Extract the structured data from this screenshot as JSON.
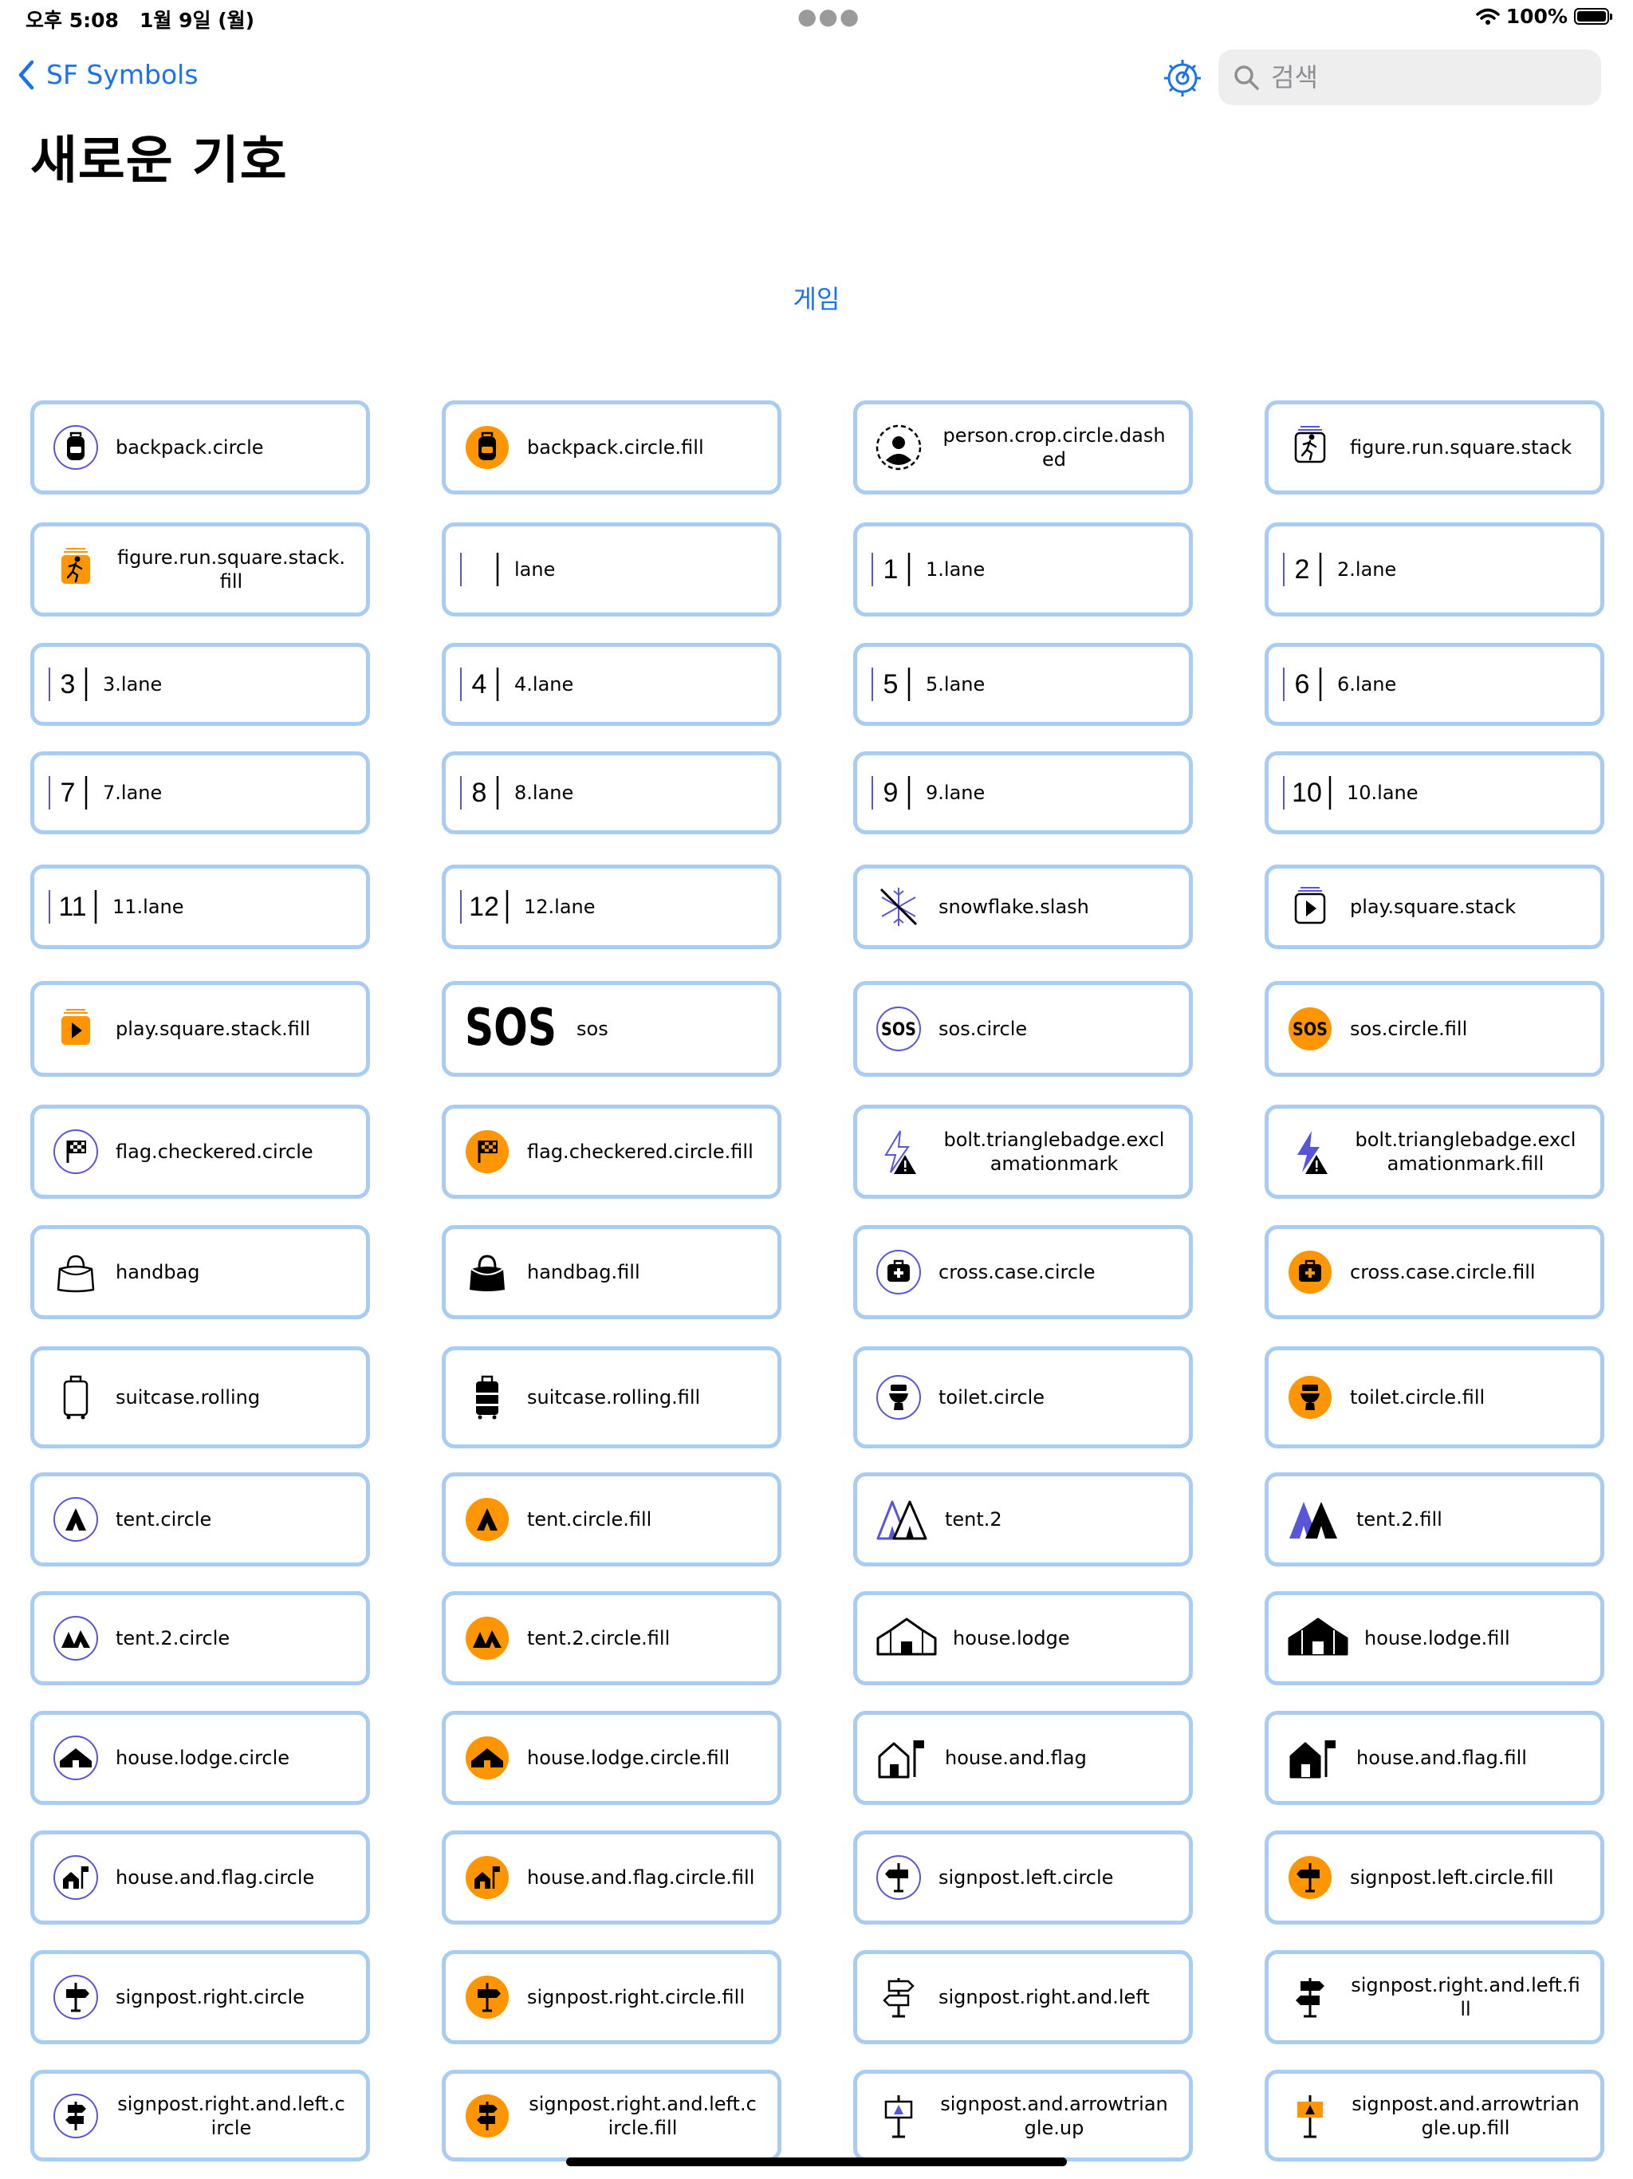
{
  "status_bar": {
    "time": "오후 5:08",
    "date": "1월 9일 (월)",
    "battery": "100%"
  },
  "nav": {
    "back_label": "SF Symbols",
    "search_placeholder": "검색"
  },
  "page_title": "새로운 기호",
  "section_label": "게임",
  "colors": {
    "accent": "#1a73e8",
    "card_border": "#a9ccf3",
    "fill_orange": "#ff9500",
    "purple": "#5856d6"
  },
  "symbols": [
    {
      "label": "backpack.circle",
      "icon": "backpack"
    },
    {
      "label": "backpack.circle.fill",
      "icon": "backpack-fill"
    },
    {
      "label": "person.crop.circle.dashed",
      "icon": "person-dashed",
      "wrap": true
    },
    {
      "label": "figure.run.square.stack",
      "icon": "run-stack"
    },
    {
      "label": "figure.run.square.stack.fill",
      "icon": "run-stack-fill",
      "wrap": true
    },
    {
      "label": "lane",
      "icon": "lane",
      "lane": ""
    },
    {
      "label": "1.lane",
      "icon": "lane",
      "lane": "1"
    },
    {
      "label": "2.lane",
      "icon": "lane",
      "lane": "2"
    },
    {
      "label": "3.lane",
      "icon": "lane",
      "lane": "3"
    },
    {
      "label": "4.lane",
      "icon": "lane",
      "lane": "4"
    },
    {
      "label": "5.lane",
      "icon": "lane",
      "lane": "5"
    },
    {
      "label": "6.lane",
      "icon": "lane",
      "lane": "6"
    },
    {
      "label": "7.lane",
      "icon": "lane",
      "lane": "7"
    },
    {
      "label": "8.lane",
      "icon": "lane",
      "lane": "8"
    },
    {
      "label": "9.lane",
      "icon": "lane",
      "lane": "9"
    },
    {
      "label": "10.lane",
      "icon": "lane",
      "lane": "10"
    },
    {
      "label": "11.lane",
      "icon": "lane",
      "lane": "11"
    },
    {
      "label": "12.lane",
      "icon": "lane",
      "lane": "12"
    },
    {
      "label": "snowflake.slash",
      "icon": "snowflake-slash"
    },
    {
      "label": "play.square.stack",
      "icon": "play-stack"
    },
    {
      "label": "play.square.stack.fill",
      "icon": "play-stack-fill"
    },
    {
      "label": "sos",
      "icon": "sos",
      "glyph": "SOS"
    },
    {
      "label": "sos.circle",
      "icon": "sos-circle",
      "glyph": "SOS"
    },
    {
      "label": "sos.circle.fill",
      "icon": "sos-circle-fill",
      "glyph": "SOS"
    },
    {
      "label": "flag.checkered.circle",
      "icon": "flag-checkered"
    },
    {
      "label": "flag.checkered.circle.fill",
      "icon": "flag-checkered-fill"
    },
    {
      "label": "bolt.trianglebadge.exclamationmark",
      "icon": "bolt-badge",
      "wrap": true
    },
    {
      "label": "bolt.trianglebadge.exclamationmark.fill",
      "icon": "bolt-badge-fill",
      "wrap": true
    },
    {
      "label": "handbag",
      "icon": "handbag"
    },
    {
      "label": "handbag.fill",
      "icon": "handbag-fill"
    },
    {
      "label": "cross.case.circle",
      "icon": "cross-case"
    },
    {
      "label": "cross.case.circle.fill",
      "icon": "cross-case-fill"
    },
    {
      "label": "suitcase.rolling",
      "icon": "suitcase"
    },
    {
      "label": "suitcase.rolling.fill",
      "icon": "suitcase-fill"
    },
    {
      "label": "toilet.circle",
      "icon": "toilet"
    },
    {
      "label": "toilet.circle.fill",
      "icon": "toilet-fill"
    },
    {
      "label": "tent.circle",
      "icon": "tent-circle"
    },
    {
      "label": "tent.circle.fill",
      "icon": "tent-circle-fill"
    },
    {
      "label": "tent.2",
      "icon": "tent2"
    },
    {
      "label": "tent.2.fill",
      "icon": "tent2-fill"
    },
    {
      "label": "tent.2.circle",
      "icon": "tent2-circle"
    },
    {
      "label": "tent.2.circle.fill",
      "icon": "tent2-circle-fill"
    },
    {
      "label": "house.lodge",
      "icon": "lodge"
    },
    {
      "label": "house.lodge.fill",
      "icon": "lodge-fill"
    },
    {
      "label": "house.lodge.circle",
      "icon": "lodge-circle"
    },
    {
      "label": "house.lodge.circle.fill",
      "icon": "lodge-circle-fill"
    },
    {
      "label": "house.and.flag",
      "icon": "house-flag"
    },
    {
      "label": "house.and.flag.fill",
      "icon": "house-flag-fill"
    },
    {
      "label": "house.and.flag.circle",
      "icon": "house-flag-circle"
    },
    {
      "label": "house.and.flag.circle.fill",
      "icon": "house-flag-circle-fill"
    },
    {
      "label": "signpost.left.circle",
      "icon": "signpost-left"
    },
    {
      "label": "signpost.left.circle.fill",
      "icon": "signpost-left-fill"
    },
    {
      "label": "signpost.right.circle",
      "icon": "signpost-right"
    },
    {
      "label": "signpost.right.circle.fill",
      "icon": "signpost-right-fill"
    },
    {
      "label": "signpost.right.and.left",
      "icon": "signpost-rl"
    },
    {
      "label": "signpost.right.and.left.fill",
      "icon": "signpost-rl-fill",
      "wrap": true
    },
    {
      "label": "signpost.right.and.left.circle",
      "icon": "signpost-rl-circle",
      "wrap": true
    },
    {
      "label": "signpost.right.and.left.circle.fill",
      "icon": "signpost-rl-circle-fill",
      "wrap": true
    },
    {
      "label": "signpost.and.arrowtriangle.up",
      "icon": "signpost-arrow",
      "wrap": true
    },
    {
      "label": "signpost.and.arrowtriangle.up.fill",
      "icon": "signpost-arrow-fill",
      "wrap": true
    }
  ]
}
